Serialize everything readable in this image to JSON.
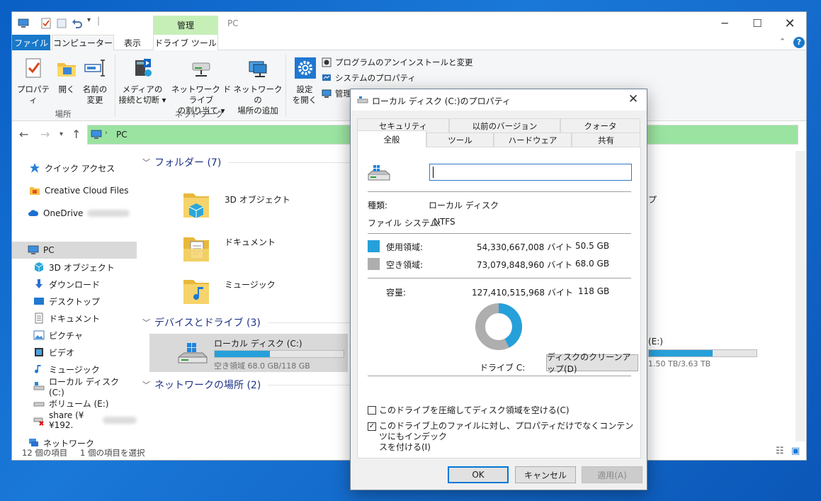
{
  "explorer": {
    "title": "PC",
    "manage_tab": "管理",
    "tabs": {
      "file": "ファイル",
      "computer": "コンピューター",
      "view": "表示",
      "drive_tools": "ドライブ ツール"
    },
    "ribbon": {
      "properties": "プロパティ",
      "open": "開く",
      "rename_l1": "名前の",
      "rename_l2": "変更",
      "group_location": "場所",
      "media_l1": "メディアの",
      "media_l2": "接続と切断 ▾",
      "mapdrive_l1": "ネットワーク ドライブ",
      "mapdrive_l2": "の割り当て ▾",
      "addloc_l1": "ネットワークの",
      "addloc_l2": "場所の追加",
      "group_network": "ネットワーク",
      "settings_l1": "設定",
      "settings_l2": "を開く",
      "uninstall": "プログラムのアンインストールと変更",
      "sysprops": "システムのプロパティ",
      "manage": "管理"
    },
    "address": "PC",
    "nav": {
      "quick_access": "クイック アクセス",
      "creative_cloud": "Creative Cloud Files",
      "onedrive": "OneDrive",
      "pc": "PC",
      "objects3d": "3D オブジェクト",
      "downloads": "ダウンロード",
      "desktop": "デスクトップ",
      "documents": "ドキュメント",
      "pictures": "ピクチャ",
      "videos": "ビデオ",
      "music": "ミュージック",
      "local_disk": "ローカル ディスク (C:)",
      "volume": "ボリューム (E:)",
      "share": "share (¥¥192.",
      "network": "ネットワーク"
    },
    "content": {
      "folders_header": "フォルダー (7)",
      "folders": [
        "3D オブジェクト",
        "ドキュメント",
        "ミュージック"
      ],
      "partial_folder_tail": "プ",
      "devices_header": "デバイスとドライブ (3)",
      "drive_c_name": "ローカル ディスク (C:)",
      "drive_c_free": "空き領域 68.0 GB/118 GB",
      "drive_c_used_fraction": 0.43,
      "drive_e_tail": "(E:)",
      "drive_e_size": "1.50 TB/3.63 TB",
      "drive_e_used_fraction": 0.59,
      "network_header": "ネットワークの場所 (2)"
    },
    "status": {
      "count": "12 個の項目",
      "selected": "1 個の項目を選択"
    }
  },
  "dialog": {
    "title": "ローカル ディスク (C:)のプロパティ",
    "tabs_row1": [
      "セキュリティ",
      "以前のバージョン",
      "クォータ"
    ],
    "tabs_row2": [
      "全般",
      "ツール",
      "ハードウェア",
      "共有"
    ],
    "name_value": "",
    "type_label": "種類:",
    "type_value": "ローカル ディスク",
    "fs_label": "ファイル システム:",
    "fs_value": "NTFS",
    "used_label": "使用領域:",
    "used_bytes": "54,330,667,008 バイト",
    "used_gb": "50.5 GB",
    "free_label": "空き領域:",
    "free_bytes": "73,079,848,960 バイト",
    "free_gb": "68.0 GB",
    "cap_label": "容量:",
    "cap_bytes": "127,410,515,968 バイト",
    "cap_gb": "118 GB",
    "drive_label": "ドライブ C:",
    "cleanup_button": "ディスクのクリーンアップ(D)",
    "compress_label": "このドライブを圧縮してディスク領域を空ける(C)",
    "index_label_l1": "このドライブ上のファイルに対し、プロパティだけでなくコンテンツにもインデック",
    "index_label_l2": "スを付ける(I)",
    "ok": "OK",
    "cancel": "キャンセル",
    "apply": "適用(A)",
    "colors": {
      "used": "#26a0da",
      "free": "#aeaeae"
    },
    "used_fraction": 0.426
  }
}
